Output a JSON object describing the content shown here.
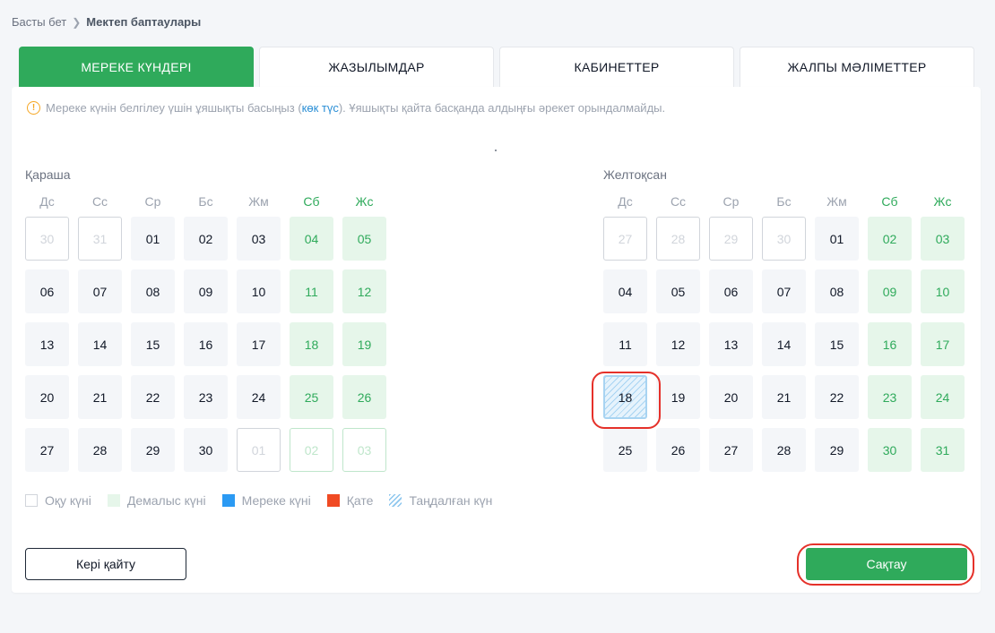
{
  "breadcrumb": {
    "home": "Басты бет",
    "current": "Мектеп баптаулары"
  },
  "tabs": [
    "МЕРЕКЕ КҮНДЕРІ",
    "ЖАЗЫЛЫМДАР",
    "КАБИНЕТТЕР",
    "ЖАЛПЫ МӘЛІМЕТТЕР"
  ],
  "active_tab": 0,
  "info": {
    "text_before": "Мереке күнін белгілеу үшін ұяшықты басыңыз (",
    "link": "көк түс",
    "text_after": "). Ұяшықты қайта басқанда алдыңғы әрекет орындалмайды."
  },
  "weekdays": [
    "Дс",
    "Сс",
    "Ср",
    "Бс",
    "Жм",
    "Сб",
    "Жс"
  ],
  "months": [
    {
      "name": "Қараша",
      "days": [
        {
          "d": "30",
          "out": true
        },
        {
          "d": "31",
          "out": true
        },
        {
          "d": "01"
        },
        {
          "d": "02"
        },
        {
          "d": "03"
        },
        {
          "d": "04"
        },
        {
          "d": "05"
        },
        {
          "d": "06"
        },
        {
          "d": "07"
        },
        {
          "d": "08"
        },
        {
          "d": "09"
        },
        {
          "d": "10"
        },
        {
          "d": "11"
        },
        {
          "d": "12"
        },
        {
          "d": "13"
        },
        {
          "d": "14"
        },
        {
          "d": "15"
        },
        {
          "d": "16"
        },
        {
          "d": "17"
        },
        {
          "d": "18"
        },
        {
          "d": "19"
        },
        {
          "d": "20"
        },
        {
          "d": "21"
        },
        {
          "d": "22"
        },
        {
          "d": "23"
        },
        {
          "d": "24"
        },
        {
          "d": "25"
        },
        {
          "d": "26"
        },
        {
          "d": "27"
        },
        {
          "d": "28"
        },
        {
          "d": "29"
        },
        {
          "d": "30"
        },
        {
          "d": "01",
          "out": true
        },
        {
          "d": "02",
          "out": true
        },
        {
          "d": "03",
          "out": true
        }
      ]
    },
    {
      "name": "Желтоқсан",
      "days": [
        {
          "d": "27",
          "out": true
        },
        {
          "d": "28",
          "out": true
        },
        {
          "d": "29",
          "out": true
        },
        {
          "d": "30",
          "out": true
        },
        {
          "d": "01"
        },
        {
          "d": "02"
        },
        {
          "d": "03"
        },
        {
          "d": "04"
        },
        {
          "d": "05"
        },
        {
          "d": "06"
        },
        {
          "d": "07"
        },
        {
          "d": "08"
        },
        {
          "d": "09"
        },
        {
          "d": "10"
        },
        {
          "d": "11"
        },
        {
          "d": "12"
        },
        {
          "d": "13"
        },
        {
          "d": "14"
        },
        {
          "d": "15"
        },
        {
          "d": "16"
        },
        {
          "d": "17"
        },
        {
          "d": "18",
          "selected": true
        },
        {
          "d": "19"
        },
        {
          "d": "20"
        },
        {
          "d": "21"
        },
        {
          "d": "22"
        },
        {
          "d": "23"
        },
        {
          "d": "24"
        },
        {
          "d": "25"
        },
        {
          "d": "26"
        },
        {
          "d": "27"
        },
        {
          "d": "28"
        },
        {
          "d": "29"
        },
        {
          "d": "30"
        },
        {
          "d": "31"
        }
      ]
    }
  ],
  "legend": [
    {
      "label": "Оқу күні",
      "type": "study"
    },
    {
      "label": "Демалыс күні",
      "type": "rest"
    },
    {
      "label": "Мереке күні",
      "type": "holiday"
    },
    {
      "label": "Қате",
      "type": "error"
    },
    {
      "label": "Таңдалған күн",
      "type": "chosen"
    }
  ],
  "buttons": {
    "back": "Кері қайту",
    "save": "Сақтау"
  },
  "colors": {
    "accent": "#2faa5b",
    "link": "#2b8fd6",
    "holiday": "#2b9af3",
    "error": "#f04a23",
    "highlight": "#e5312a"
  }
}
